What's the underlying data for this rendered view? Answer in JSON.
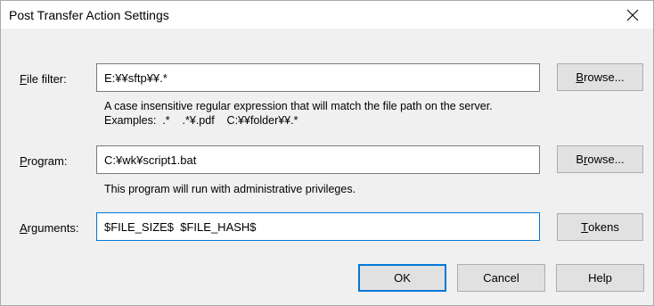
{
  "window": {
    "title": "Post Transfer Action Settings",
    "close_icon": "close-icon"
  },
  "file_filter": {
    "label_accel": "F",
    "label_rest": "ile filter:",
    "value": "E:¥¥sftp¥¥.*",
    "browse_accel": "B",
    "browse_rest": "rowse...",
    "hint_line1": "A case insensitive regular expression that will match the file path on the server.",
    "hint_line2": "Examples:  .*    .*¥.pdf    C:¥¥folder¥¥.*"
  },
  "program": {
    "label_accel": "P",
    "label_rest": "rogram:",
    "value": "C:¥wk¥script1.bat",
    "browse_pre": "B",
    "browse_accel": "r",
    "browse_rest": "owse...",
    "hint": "This program will run with administrative privileges."
  },
  "arguments": {
    "label_accel": "A",
    "label_rest": "rguments:",
    "value": "$FILE_SIZE$  $FILE_HASH$",
    "tokens_accel": "T",
    "tokens_rest": "okens"
  },
  "footer": {
    "ok_label": "OK",
    "cancel_label": "Cancel",
    "help_label": "Help"
  },
  "colors": {
    "focus_accent": "#0078d7",
    "dialog_bg": "#f0f0f0",
    "button_bg": "#e1e1e1"
  }
}
